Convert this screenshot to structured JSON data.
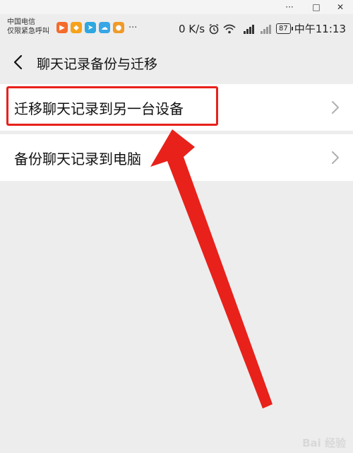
{
  "window": {
    "minimize_glyph": "···",
    "maximize_glyph": "□",
    "close_glyph": "✕"
  },
  "status_bar": {
    "carrier_line1": "中国电信",
    "carrier_line2": "仅限紧急呼叫",
    "more_dots": "···",
    "net_speed": "0 K/s",
    "battery": "87",
    "time": "中午11:13",
    "app_icons": [
      "video-app-icon",
      "orange-app-icon",
      "kite-app-icon",
      "cloud-app-icon",
      "game-app-icon"
    ]
  },
  "header": {
    "title": "聊天记录备份与迁移"
  },
  "list": {
    "items": [
      {
        "label": "迁移聊天记录到另一台设备"
      },
      {
        "label": "备份聊天记录到电脑"
      }
    ]
  },
  "annotation": {
    "color": "#e8211b"
  },
  "watermark": {
    "text": "Bai 经验"
  }
}
